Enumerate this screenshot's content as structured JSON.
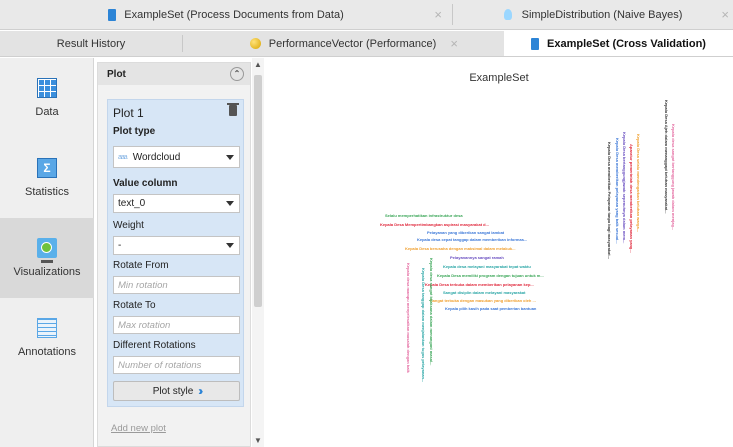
{
  "tabs_top": [
    {
      "label": "ExampleSet (Process Documents from Data)",
      "icon": "document-icon"
    },
    {
      "label": "SimpleDistribution (Naive Bayes)",
      "icon": "lightbulb-icon"
    }
  ],
  "tabs_second": [
    {
      "label": "Result History"
    },
    {
      "label": "PerformanceVector (Performance)",
      "icon": "performance-icon"
    },
    {
      "label": "ExampleSet (Cross Validation)",
      "icon": "document-icon",
      "active": true
    }
  ],
  "sidenav": [
    {
      "label": "Data",
      "icon": "table-icon"
    },
    {
      "label": "Statistics",
      "icon": "statistics-icon"
    },
    {
      "label": "Visualizations",
      "icon": "visualizations-icon",
      "active": true
    },
    {
      "label": "Annotations",
      "icon": "annotations-icon"
    }
  ],
  "panel": {
    "header": "Plot",
    "plot_title": "Plot 1",
    "plot_type_label": "Plot type",
    "plot_type_value": "Wordcloud",
    "plot_type_icon_text": "aaa",
    "value_column_label": "Value column",
    "value_column_value": "text_0",
    "weight_label": "Weight",
    "weight_value": "-",
    "rotate_from_label": "Rotate From",
    "rotate_from_placeholder": "Min rotation",
    "rotate_to_label": "Rotate To",
    "rotate_to_placeholder": "Max rotation",
    "diff_rotations_label": "Different Rotations",
    "diff_rotations_placeholder": "Number of rotations",
    "plot_style_label": "Plot style",
    "add_plot_label": "Add new plot"
  },
  "chart": {
    "title": "ExampleSet",
    "colors": {
      "red": "#e0283c",
      "blue": "#3c78d8",
      "green": "#3aa657",
      "orange": "#f0a030",
      "teal": "#2aa6a6",
      "pink": "#e46aa0",
      "purple": "#6a4fc1",
      "dark": "#333333"
    },
    "words_horizontal": [
      {
        "text": "Selalu memperhatikan infrastruktur desa",
        "color": "green"
      },
      {
        "text": "Kepala Desa Mempertimbangkan aspirasi masyarakat d...",
        "color": "red"
      },
      {
        "text": "Pelayanan yang diberikan sangat lambat",
        "color": "blue"
      },
      {
        "text": "Kepala desa cepat tanggap dalam memberikan informas...",
        "color": "blue"
      },
      {
        "text": "Kepala Desa berusaha dengan maksimal dalam melakuk...",
        "color": "orange"
      },
      {
        "text": "Pelayanannya sangat ramah",
        "color": "purple"
      },
      {
        "text": "Kepala desa melayani masyarakat tepat waktu",
        "color": "teal"
      },
      {
        "text": "Kepala Desa memiliki program dengan tujuan untuk m...",
        "color": "green"
      },
      {
        "text": "Kepala Desa terbuka dalam memberikan pelayanan kep...",
        "color": "red"
      },
      {
        "text": "Sangat disiplin dalam melayani masyarakat",
        "color": "teal"
      },
      {
        "text": "Sangat terbuka dengan masukan yang diberikan oleh ...",
        "color": "orange"
      },
      {
        "text": "Kepala pilih kasih pada saat pemberian bantuan",
        "color": "blue"
      }
    ],
    "words_vertical": [
      {
        "text": "Kepala Desa memberikan Pelayanan tanpa bagi masyarakat...",
        "color": "dark"
      },
      {
        "text": "Kepala Desa memberikan pelayanan yang baik sesuai...",
        "color": "blue"
      },
      {
        "text": "Kepala Desa bertanggungjawab sepenuhnya dalam mem...",
        "color": "purple"
      },
      {
        "text": "Aparatur pemerintah desa memberikan pelayanan yang...",
        "color": "red"
      },
      {
        "text": "Kepala Desa selalu mendengarkan keluhan warga...",
        "color": "orange"
      },
      {
        "text": "Kepala Desa Ajeh dalam menanggapi keluhan masyarakat...",
        "color": "dark"
      },
      {
        "text": "Kepala desa sangat bertanggung jawab dalam menjag...",
        "color": "pink"
      },
      {
        "text": "Kepala desa sangat bijaksana dalam menangani masal...",
        "color": "green"
      },
      {
        "text": "Kepala desa mampu menyelesaikan masalah dengan baik",
        "color": "pink"
      },
      {
        "text": "Kepala Desa tanggap dalam menjalankan tugas pelayanan...",
        "color": "teal"
      }
    ]
  }
}
